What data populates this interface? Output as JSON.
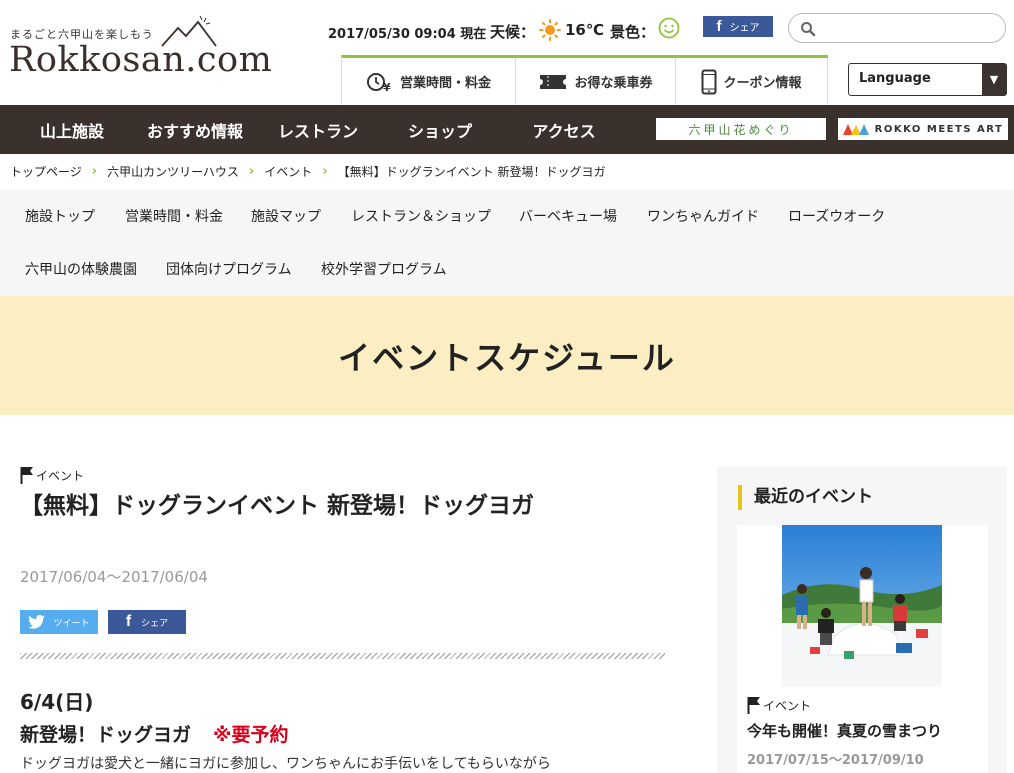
{
  "header": {
    "tagline": "まるごと六甲山を楽しもう",
    "logo": "Rokkosan.com",
    "datetime": "2017/05/30 09:04 現在",
    "weather_label": "天候：",
    "temperature": "16℃",
    "view_label": "景色：",
    "fb_share": "シェア",
    "search_placeholder": "",
    "quick_links": [
      {
        "label": "営業時間・料金",
        "icon": "clock-yen-icon"
      },
      {
        "label": "お得な乗車券",
        "icon": "ticket-icon"
      },
      {
        "label": "クーポン情報",
        "icon": "smartphone-icon"
      }
    ],
    "language": "Language"
  },
  "nav": {
    "items": [
      "山上施設",
      "おすすめ情報",
      "レストラン",
      "ショップ",
      "アクセス"
    ],
    "banner_flower": "六甲山花めぐり",
    "banner_art": "ROKKO MEETS ART"
  },
  "breadcrumb": [
    "トップページ",
    "六甲山カンツリーハウス",
    "イベント",
    "【無料】ドッグランイベント 新登場！ドッグヨガ"
  ],
  "subnav": {
    "items": [
      "施設トップ",
      "営業時間・料金",
      "施設マップ",
      "レストラン＆ショップ",
      "バーベキュー場",
      "ワンちゃんガイド",
      "ローズウオーク",
      "六甲山の体験農園",
      "団体向けプログラム",
      "校外学習プログラム"
    ]
  },
  "page_title": "イベントスケジュール",
  "article": {
    "category": "イベント",
    "title": "【無料】ドッグランイベント 新登場！ドッグヨガ",
    "dates": "2017/06/04〜2017/06/04",
    "tweet_label": "ツイート",
    "share_label": "シェア",
    "day": "6/4(日)",
    "subtitle": "新登場！ドッグヨガ",
    "reservation": "※要予約",
    "body": "ドッグヨガは愛犬と一緒にヨガに参加し、ワンちゃんにお手伝いをしてもらいながら"
  },
  "sidebar": {
    "heading": "最近のイベント",
    "event_category": "イベント",
    "event_title": "今年も開催！真夏の雪まつり",
    "event_dates": "2017/07/15〜2017/09/10"
  },
  "colors": {
    "nav_bg": "#3a302c",
    "accent_green": "#8cc63f",
    "band_bg": "#faeec2",
    "twitter": "#55acee",
    "facebook": "#3b5998",
    "required_red": "#d9001b"
  }
}
